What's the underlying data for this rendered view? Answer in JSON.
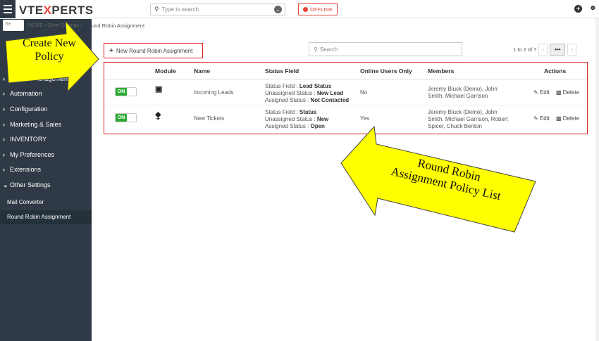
{
  "topbar": {
    "logo_pre": "VTE",
    "logo_x": "X",
    "logo_post": "PERTS",
    "search_placeholder": "Type to search",
    "offline_label": "OFFLINE"
  },
  "breadcrumb": {
    "pre": "HOME › Other Settings ›",
    "current": "und Robin Assignment"
  },
  "sidebar": {
    "search_placeholder": "Se",
    "items": [
      {
        "label": "Module Management"
      },
      {
        "label": "Automation"
      },
      {
        "label": "Configuration"
      },
      {
        "label": "Marketing & Sales"
      },
      {
        "label": "INVENTORY"
      },
      {
        "label": "My Preferences"
      },
      {
        "label": "Extensions"
      },
      {
        "label": "Other Settings"
      }
    ],
    "sub_items": [
      {
        "label": "Mail Converter"
      },
      {
        "label": "Round Robin Assignment"
      }
    ]
  },
  "toolbar": {
    "new_button": "New Round Robin Assignment",
    "search_placeholder": "Search",
    "pager_text": "1 to 2  of ?"
  },
  "table": {
    "headers": [
      "Module",
      "Name",
      "Status Field",
      "Online Users Only",
      "Members",
      "Actions"
    ],
    "rows": [
      {
        "toggle": "ON",
        "name": "Incoming Leads",
        "status_field_label": "Status Field : ",
        "status_field_value": "Lead Status",
        "unassigned_label": "Unassigned Status : ",
        "unassigned_value": "New Lead",
        "assigned_label": "Assigned Status : ",
        "assigned_value": "Not Contacted",
        "online": "No",
        "members_1": "Jeremy Bluck (Demo), John",
        "members_2": "Smith, Michael Garrison",
        "members_3": "",
        "edit": "Edit",
        "delete": "Delete"
      },
      {
        "toggle": "ON",
        "name": "New Tickets",
        "status_field_label": "Status Field : ",
        "status_field_value": "Status",
        "unassigned_label": "Unassigned Status : ",
        "unassigned_value": "New",
        "assigned_label": "Assigned Status : ",
        "assigned_value": "Open",
        "online": "Yes",
        "members_1": "Jeremy Bluck (Demo), John",
        "members_2": "Smith, Michael Garrison, Robert",
        "members_3": "Spicer, Chuck Benton",
        "edit": "Edit",
        "delete": "Delete"
      }
    ]
  },
  "callouts": {
    "create_line1": "Create New",
    "create_line2": "Policy",
    "list_line1": "Round Robin",
    "list_line2": "Assignment Policy List"
  },
  "colors": {
    "sidebar_bg": "#2f3a46",
    "highlight_red": "#d9231d",
    "toggle_green": "#2bab33",
    "callout_yellow": "#ffff00"
  }
}
